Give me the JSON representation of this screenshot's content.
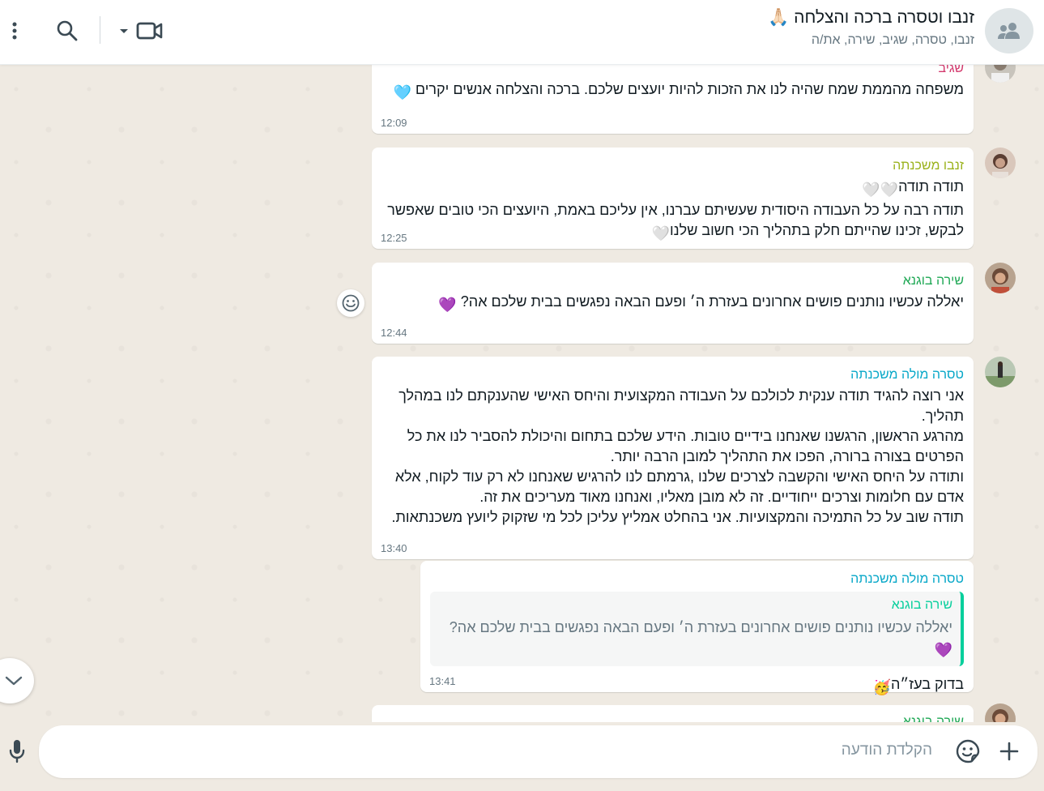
{
  "header": {
    "title": "זנבו וטסרה ברכה והצלחה",
    "title_emoji": "🙏🏻",
    "participants": "זנבו, טסרה, שגיב, שירה, את/ה"
  },
  "messages": [
    {
      "sender": "שגיב",
      "sender_color": "#d3396d",
      "text": "משפחה מהממת שמח שהיה לנו את הזכות להיות יועצים שלכם. ברכה והצלחה אנשים יקרים",
      "emoji": "🩵",
      "time": "12:09"
    },
    {
      "sender": "זנבו משכנתה",
      "sender_color": "#9ab21c",
      "text_line1": "תודה תודה",
      "text_line1_emoji": "🤍🤍",
      "text_line2": "תודה רבה על כל העבודה היסודית שעשיתם עברנו, אין עליכם באמת, היועצים הכי טובים שאפשר לבקש, זכינו שהייתם חלק בתהליך הכי חשוב שלנו",
      "text_line2_emoji": "🤍",
      "time": "12:25"
    },
    {
      "sender": "שירה בוגנא",
      "sender_color": "#1fa855",
      "text": "יאללה עכשיו נותנים פושים אחרונים בעזרת ה׳ ופעם הבאה נפגשים בבית שלכם אה?",
      "emoji": "💜",
      "time": "12:44"
    },
    {
      "sender": "טסרה מולה משכנתה",
      "sender_color": "#06a7c8",
      "text": "אני רוצה להגיד תודה ענקית לכולכם על העבודה המקצועית והיחס האישי שהענקתם לנו במהלך תהליך.\nמהרגע הראשון, הרגשנו שאנחנו בידיים טובות. הידע שלכם בתחום והיכולת להסביר לנו את כל הפרטים בצורה ברורה, הפכו את התהליך למובן הרבה יותר.\nותודה על היחס האישי והקשבה לצרכים שלנו ,גרמתם לנו להרגיש שאנחנו לא רק עוד לקוח, אלא אדם עם חלומות וצרכים ייחודיים. זה לא מובן מאליו, ואנחנו מאוד מעריכים את זה.\nתודה שוב על כל התמיכה והמקצועיות. אני בהחלט אמליץ עליכן לכל מי שזקוק ליועץ משכנתאות.",
      "time": "13:40"
    },
    {
      "sender": "טסרה מולה משכנתה",
      "sender_color": "#06a7c8",
      "quote": {
        "sender": "שירה בוגנא",
        "text": "יאללה עכשיו נותנים פושים אחרונים בעזרת ה׳ ופעם הבאה נפגשים בבית שלכם אה?",
        "emoji": "💜"
      },
      "text": "בדוק בעז״ה",
      "emoji": "🥳",
      "time": "13:41"
    },
    {
      "sender": "שירה בוגנא",
      "sender_color": "#1fa855"
    }
  ],
  "composer": {
    "placeholder": "הקלדת הודעה"
  },
  "icons": [
    "group-icon",
    "menu-icon",
    "search-icon",
    "video-call-icon",
    "chevron-down-icon",
    "smiley-icon",
    "plus-icon",
    "sticker-icon",
    "mic-icon"
  ]
}
